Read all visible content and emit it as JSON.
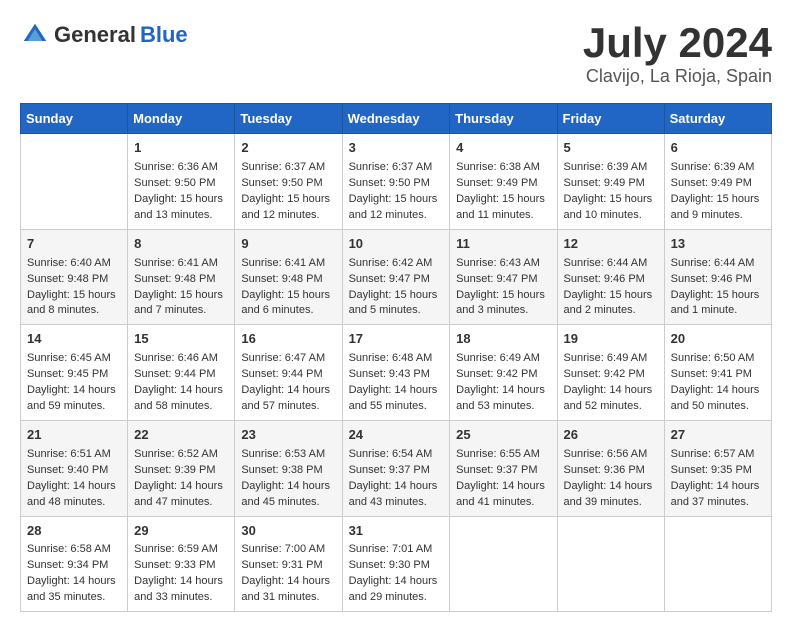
{
  "header": {
    "logo_general": "General",
    "logo_blue": "Blue",
    "month_title": "July 2024",
    "location": "Clavijo, La Rioja, Spain"
  },
  "weekdays": [
    "Sunday",
    "Monday",
    "Tuesday",
    "Wednesday",
    "Thursday",
    "Friday",
    "Saturday"
  ],
  "weeks": [
    [
      {
        "day": "",
        "sunrise": "",
        "sunset": "",
        "daylight": ""
      },
      {
        "day": "1",
        "sunrise": "Sunrise: 6:36 AM",
        "sunset": "Sunset: 9:50 PM",
        "daylight": "Daylight: 15 hours and 13 minutes."
      },
      {
        "day": "2",
        "sunrise": "Sunrise: 6:37 AM",
        "sunset": "Sunset: 9:50 PM",
        "daylight": "Daylight: 15 hours and 12 minutes."
      },
      {
        "day": "3",
        "sunrise": "Sunrise: 6:37 AM",
        "sunset": "Sunset: 9:50 PM",
        "daylight": "Daylight: 15 hours and 12 minutes."
      },
      {
        "day": "4",
        "sunrise": "Sunrise: 6:38 AM",
        "sunset": "Sunset: 9:49 PM",
        "daylight": "Daylight: 15 hours and 11 minutes."
      },
      {
        "day": "5",
        "sunrise": "Sunrise: 6:39 AM",
        "sunset": "Sunset: 9:49 PM",
        "daylight": "Daylight: 15 hours and 10 minutes."
      },
      {
        "day": "6",
        "sunrise": "Sunrise: 6:39 AM",
        "sunset": "Sunset: 9:49 PM",
        "daylight": "Daylight: 15 hours and 9 minutes."
      }
    ],
    [
      {
        "day": "7",
        "sunrise": "Sunrise: 6:40 AM",
        "sunset": "Sunset: 9:48 PM",
        "daylight": "Daylight: 15 hours and 8 minutes."
      },
      {
        "day": "8",
        "sunrise": "Sunrise: 6:41 AM",
        "sunset": "Sunset: 9:48 PM",
        "daylight": "Daylight: 15 hours and 7 minutes."
      },
      {
        "day": "9",
        "sunrise": "Sunrise: 6:41 AM",
        "sunset": "Sunset: 9:48 PM",
        "daylight": "Daylight: 15 hours and 6 minutes."
      },
      {
        "day": "10",
        "sunrise": "Sunrise: 6:42 AM",
        "sunset": "Sunset: 9:47 PM",
        "daylight": "Daylight: 15 hours and 5 minutes."
      },
      {
        "day": "11",
        "sunrise": "Sunrise: 6:43 AM",
        "sunset": "Sunset: 9:47 PM",
        "daylight": "Daylight: 15 hours and 3 minutes."
      },
      {
        "day": "12",
        "sunrise": "Sunrise: 6:44 AM",
        "sunset": "Sunset: 9:46 PM",
        "daylight": "Daylight: 15 hours and 2 minutes."
      },
      {
        "day": "13",
        "sunrise": "Sunrise: 6:44 AM",
        "sunset": "Sunset: 9:46 PM",
        "daylight": "Daylight: 15 hours and 1 minute."
      }
    ],
    [
      {
        "day": "14",
        "sunrise": "Sunrise: 6:45 AM",
        "sunset": "Sunset: 9:45 PM",
        "daylight": "Daylight: 14 hours and 59 minutes."
      },
      {
        "day": "15",
        "sunrise": "Sunrise: 6:46 AM",
        "sunset": "Sunset: 9:44 PM",
        "daylight": "Daylight: 14 hours and 58 minutes."
      },
      {
        "day": "16",
        "sunrise": "Sunrise: 6:47 AM",
        "sunset": "Sunset: 9:44 PM",
        "daylight": "Daylight: 14 hours and 57 minutes."
      },
      {
        "day": "17",
        "sunrise": "Sunrise: 6:48 AM",
        "sunset": "Sunset: 9:43 PM",
        "daylight": "Daylight: 14 hours and 55 minutes."
      },
      {
        "day": "18",
        "sunrise": "Sunrise: 6:49 AM",
        "sunset": "Sunset: 9:42 PM",
        "daylight": "Daylight: 14 hours and 53 minutes."
      },
      {
        "day": "19",
        "sunrise": "Sunrise: 6:49 AM",
        "sunset": "Sunset: 9:42 PM",
        "daylight": "Daylight: 14 hours and 52 minutes."
      },
      {
        "day": "20",
        "sunrise": "Sunrise: 6:50 AM",
        "sunset": "Sunset: 9:41 PM",
        "daylight": "Daylight: 14 hours and 50 minutes."
      }
    ],
    [
      {
        "day": "21",
        "sunrise": "Sunrise: 6:51 AM",
        "sunset": "Sunset: 9:40 PM",
        "daylight": "Daylight: 14 hours and 48 minutes."
      },
      {
        "day": "22",
        "sunrise": "Sunrise: 6:52 AM",
        "sunset": "Sunset: 9:39 PM",
        "daylight": "Daylight: 14 hours and 47 minutes."
      },
      {
        "day": "23",
        "sunrise": "Sunrise: 6:53 AM",
        "sunset": "Sunset: 9:38 PM",
        "daylight": "Daylight: 14 hours and 45 minutes."
      },
      {
        "day": "24",
        "sunrise": "Sunrise: 6:54 AM",
        "sunset": "Sunset: 9:37 PM",
        "daylight": "Daylight: 14 hours and 43 minutes."
      },
      {
        "day": "25",
        "sunrise": "Sunrise: 6:55 AM",
        "sunset": "Sunset: 9:37 PM",
        "daylight": "Daylight: 14 hours and 41 minutes."
      },
      {
        "day": "26",
        "sunrise": "Sunrise: 6:56 AM",
        "sunset": "Sunset: 9:36 PM",
        "daylight": "Daylight: 14 hours and 39 minutes."
      },
      {
        "day": "27",
        "sunrise": "Sunrise: 6:57 AM",
        "sunset": "Sunset: 9:35 PM",
        "daylight": "Daylight: 14 hours and 37 minutes."
      }
    ],
    [
      {
        "day": "28",
        "sunrise": "Sunrise: 6:58 AM",
        "sunset": "Sunset: 9:34 PM",
        "daylight": "Daylight: 14 hours and 35 minutes."
      },
      {
        "day": "29",
        "sunrise": "Sunrise: 6:59 AM",
        "sunset": "Sunset: 9:33 PM",
        "daylight": "Daylight: 14 hours and 33 minutes."
      },
      {
        "day": "30",
        "sunrise": "Sunrise: 7:00 AM",
        "sunset": "Sunset: 9:31 PM",
        "daylight": "Daylight: 14 hours and 31 minutes."
      },
      {
        "day": "31",
        "sunrise": "Sunrise: 7:01 AM",
        "sunset": "Sunset: 9:30 PM",
        "daylight": "Daylight: 14 hours and 29 minutes."
      },
      {
        "day": "",
        "sunrise": "",
        "sunset": "",
        "daylight": ""
      },
      {
        "day": "",
        "sunrise": "",
        "sunset": "",
        "daylight": ""
      },
      {
        "day": "",
        "sunrise": "",
        "sunset": "",
        "daylight": ""
      }
    ]
  ]
}
